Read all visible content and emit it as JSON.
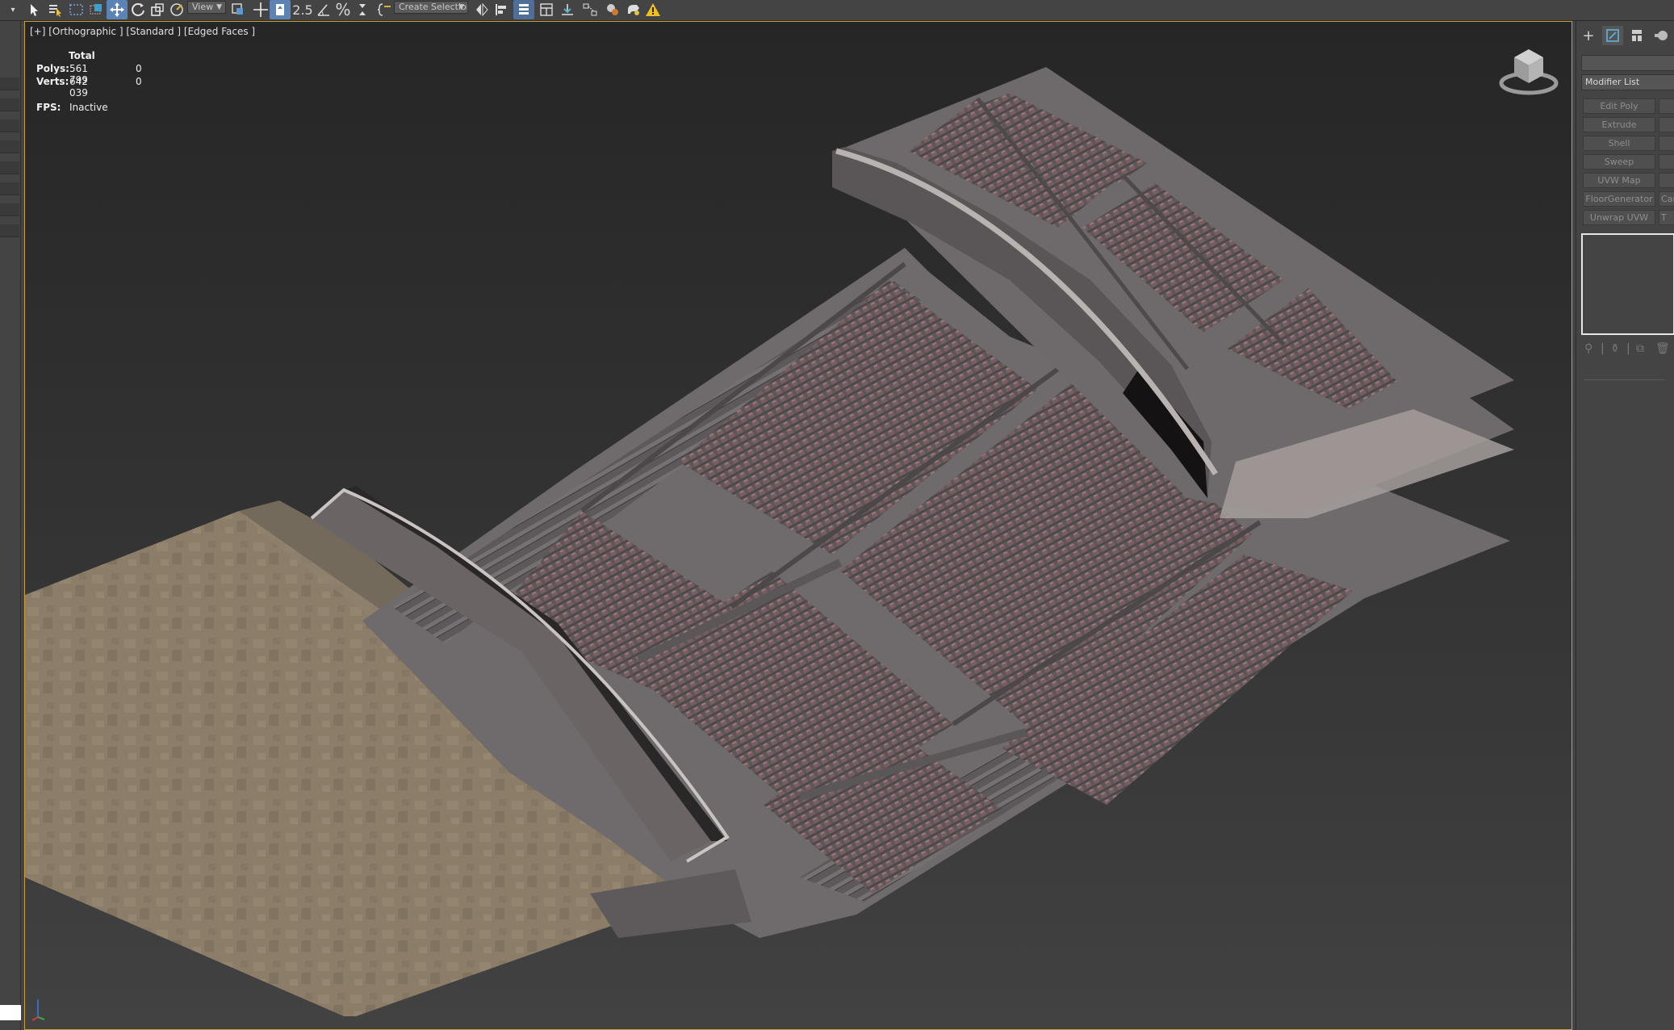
{
  "toolbar": {
    "view_dropdown": "View",
    "selection_set_dropdown": "Create Selection Se",
    "snap_label": "2.5",
    "percent_snap_label": "%"
  },
  "viewport": {
    "label": "[+] [Orthographic ] [Standard ] [Edged Faces ]",
    "stats": {
      "header": "Total",
      "polys_label": "Polys:",
      "polys_total": "561 799",
      "polys_selected": "0",
      "verts_label": "Verts:",
      "verts_total": "642 039",
      "verts_selected": "0",
      "fps_label": "FPS:",
      "fps_value": "Inactive"
    }
  },
  "command_panel": {
    "modifier_list_label": "Modifier List",
    "modifier_buttons": [
      {
        "label": "Edit Poly",
        "side": ""
      },
      {
        "label": "Extrude",
        "side": ""
      },
      {
        "label": "Shell",
        "side": ""
      },
      {
        "label": "Sweep",
        "side": ""
      },
      {
        "label": "UVW Map",
        "side": ""
      },
      {
        "label": "FloorGenerator",
        "side": "Cam"
      },
      {
        "label": "Unwrap UVW",
        "side": "T"
      }
    ]
  },
  "colors": {
    "ui_background": "#444444",
    "viewport_border": "#c8a040",
    "active_tool": "#5b83b6",
    "floor_tan": "#8b7d68",
    "concrete": "#6f6a6b",
    "seats": "#7a5d61"
  },
  "icons": [
    "select-object-icon",
    "select-by-name-icon",
    "rectangular-selection-icon",
    "window-crossing-icon",
    "move-icon",
    "rotate-icon",
    "scale-icon",
    "select-manipulate-icon",
    "use-pivot-icon",
    "snap-toggle-icon",
    "angle-snap-icon",
    "percent-snap-icon",
    "spinner-snap-icon",
    "named-selection-icon",
    "mirror-icon",
    "align-icon",
    "layer-explorer-icon",
    "scene-explorer-icon",
    "curve-editor-icon",
    "schematic-view-icon",
    "material-editor-icon",
    "render-setup-icon",
    "render-icon",
    "warning-icon",
    "create-tab-icon",
    "modify-tab-icon",
    "hierarchy-tab-icon",
    "motion-tab-icon",
    "view-cube-icon",
    "axis-tripod-icon"
  ]
}
